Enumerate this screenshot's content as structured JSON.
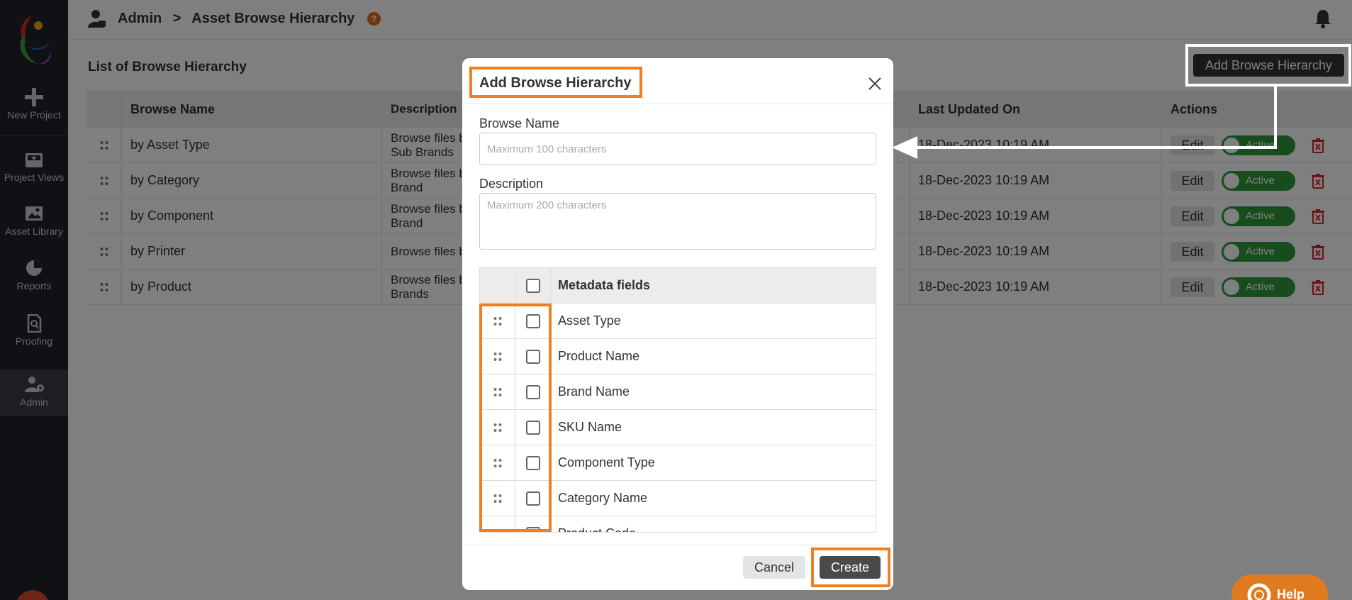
{
  "sidebar": {
    "items": [
      {
        "label": "New Project",
        "icon": "plus-icon"
      },
      {
        "label": "Project Views",
        "icon": "inbox-icon"
      },
      {
        "label": "Asset Library",
        "icon": "image-icon"
      },
      {
        "label": "Reports",
        "icon": "pie-chart-icon"
      },
      {
        "label": "Proofing",
        "icon": "document-search-icon"
      },
      {
        "label": "Admin",
        "icon": "admin-user-icon"
      }
    ]
  },
  "header": {
    "breadcrumb": [
      "Admin",
      ">",
      "Asset Browse Hierarchy"
    ],
    "help_mark": "?"
  },
  "page": {
    "title": "List of Browse Hierarchy",
    "add_button": "Add Browse Hierarchy"
  },
  "table": {
    "columns": [
      "Browse Name",
      "Description",
      "Last Updated On",
      "Actions"
    ],
    "rows": [
      {
        "name": "by Asset Type",
        "desc": "Browse files b\nSub Brands",
        "updated": "18-Dec-2023 10:19 AM"
      },
      {
        "name": "by Category",
        "desc": "Browse files b\nBrand",
        "updated": "18-Dec-2023 10:19 AM"
      },
      {
        "name": "by Component",
        "desc": "Browse files b\nBrand",
        "updated": "18-Dec-2023 10:19 AM"
      },
      {
        "name": "by Printer",
        "desc": "Browse files b",
        "updated": "18-Dec-2023 10:19 AM"
      },
      {
        "name": "by Product",
        "desc": "Browse files b\nBrands",
        "updated": "18-Dec-2023 10:19 AM"
      }
    ],
    "edit_label": "Edit",
    "toggle_label": "Active"
  },
  "modal": {
    "title": "Add Browse Hierarchy",
    "browse_name_label": "Browse Name",
    "browse_name_placeholder": "Maximum 100 characters",
    "description_label": "Description",
    "description_placeholder": "Maximum 200 characters",
    "metadata_header": "Metadata fields",
    "metadata_fields": [
      "Asset Type",
      "Product Name",
      "Brand Name",
      "SKU Name",
      "Component Type",
      "Category Name",
      "Product Code"
    ],
    "cancel": "Cancel",
    "create": "Create"
  },
  "help_button": "Help",
  "colors": {
    "sidebar_bg": "#1f2329",
    "highlight_orange": "#f07f22",
    "toggle_green": "#2e9b3a",
    "trash_red": "#d9232e"
  }
}
